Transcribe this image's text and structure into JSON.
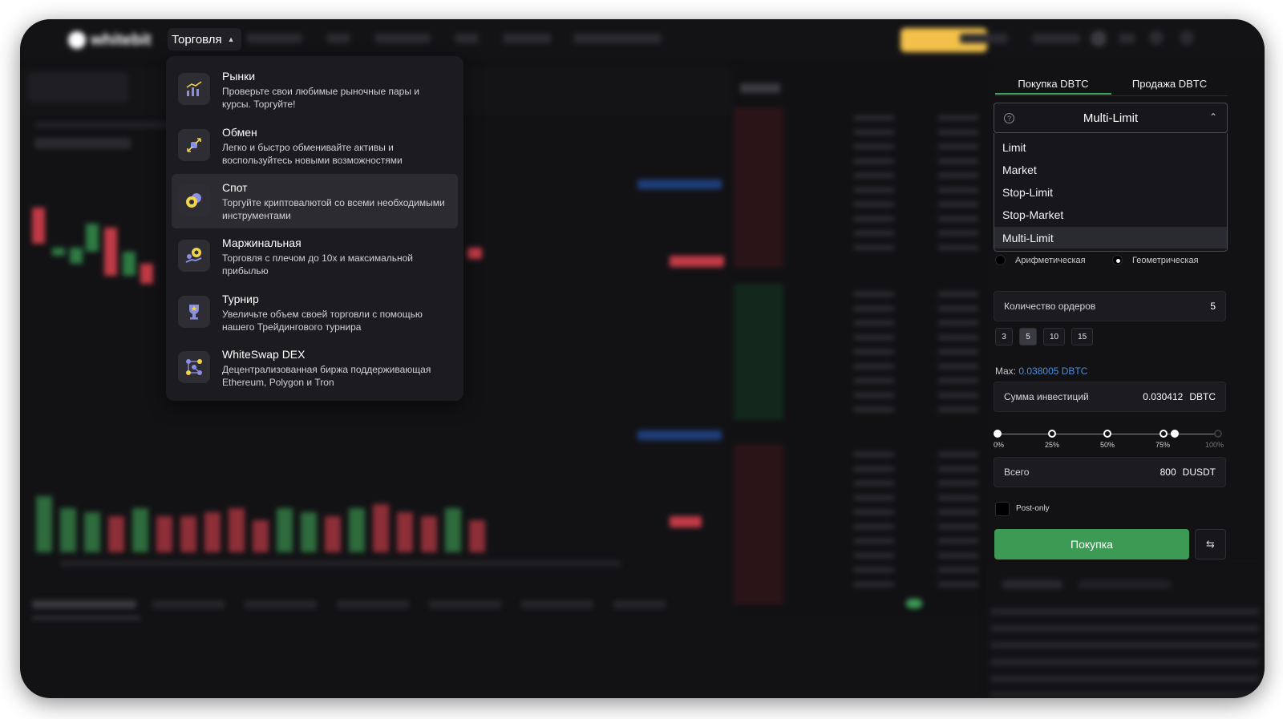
{
  "header": {
    "logo_text": "whitebit",
    "active_menu": "Торговля"
  },
  "trade_menu": {
    "items": [
      {
        "title": "Рынки",
        "desc": "Проверьте свои любимые рыночные пары и курсы. Торгуйте!",
        "icon": "chart-bars-icon"
      },
      {
        "title": "Обмен",
        "desc": "Легко и быстро обменивайте активы и воспользуйтесь новыми возможностями",
        "icon": "exchange-icon"
      },
      {
        "title": "Спот",
        "desc": "Торгуйте криптовалютой со всеми необходимыми инструментами",
        "icon": "coins-icon"
      },
      {
        "title": "Маржинальная",
        "desc": "Торговля с плечом до 10х и максимальной прибылью",
        "icon": "margin-icon"
      },
      {
        "title": "Турнир",
        "desc": "Увеличьте объем своей торговли с помощью нашего Трейдингового турнира",
        "icon": "trophy-icon"
      },
      {
        "title": "WhiteSwap DEX",
        "desc": "Децентрализованная биржа поддерживающая Ethereum, Polygon и Tron",
        "icon": "network-icon"
      }
    ]
  },
  "panel": {
    "tab_buy": "Покупка DBTC",
    "tab_sell": "Продажа DBTC",
    "order_type": "Multi-Limit",
    "options": [
      "Limit",
      "Market",
      "Stop-Limit",
      "Stop-Market",
      "Multi-Limit"
    ],
    "radio_arith": "Арифметическая",
    "radio_geom": "Геометрическая",
    "orders_label": "Количество ордеров",
    "orders_value": "5",
    "chips": [
      "3",
      "5",
      "10",
      "15"
    ],
    "max_label": "Max:",
    "max_value": "0.038005 DBTC",
    "invest_label": "Сумма инвестиций",
    "invest_value": "0.030412",
    "invest_unit": "DBTC",
    "slider_labels": [
      "0%",
      "25%",
      "50%",
      "75%",
      "100%"
    ],
    "slider_value_percent": 80,
    "total_label": "Всего",
    "total_value": "800",
    "total_unit": "DUSDT",
    "post_only": "Post-only",
    "buy_button": "Покупка"
  },
  "colors": {
    "buy_green": "#3c9a55",
    "link_blue": "#4a8ee0",
    "accent_yellow": "#f3c14a"
  }
}
